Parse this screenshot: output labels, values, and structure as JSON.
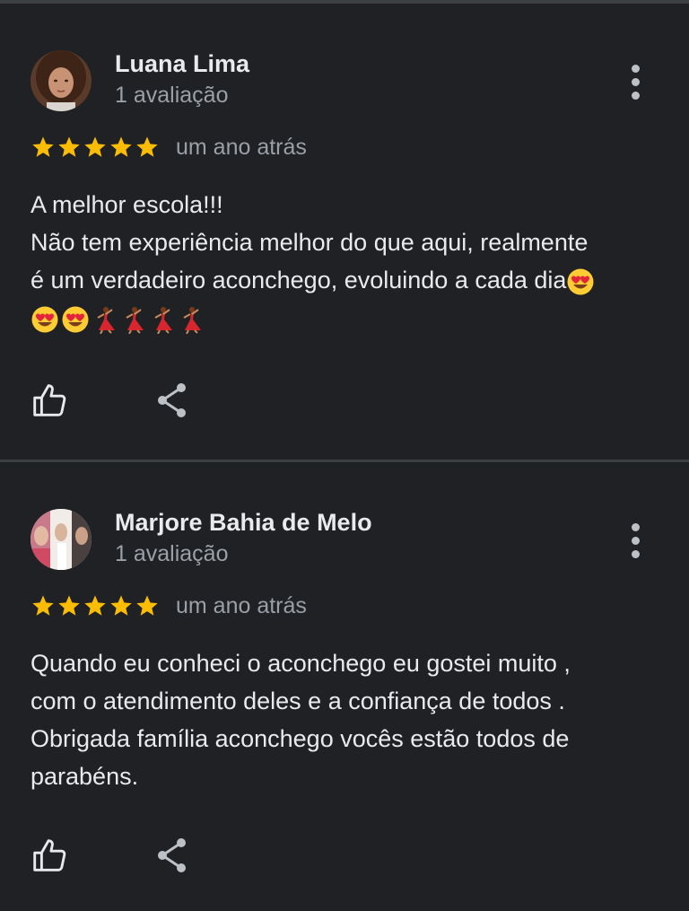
{
  "reviews": [
    {
      "author": "Luana Lima",
      "review_count": "1 avaliação",
      "rating": 5,
      "time": "um ano atrás",
      "lines": [
        "A melhor escola!!!",
        "Não tem experiência melhor do que aqui, realmente",
        "é um verdadeiro aconchego, evoluindo a cada dia"
      ],
      "emojis": [
        "😍",
        "😍",
        "😍",
        "💃",
        "💃",
        "💃",
        "💃"
      ]
    },
    {
      "author": "Marjore Bahia de Melo",
      "review_count": "1 avaliação",
      "rating": 5,
      "time": "um ano atrás",
      "lines": [
        "Quando eu conheci o aconchego eu gostei muito ,",
        "com o atendimento deles e a confiança de todos .",
        "Obrigada família aconchego vocês estão todos de",
        "parabéns."
      ]
    }
  ],
  "colors": {
    "background": "#202124",
    "star": "#fbbc04",
    "text_primary": "#e8eaed",
    "text_secondary": "#9aa0a6",
    "divider": "#3c4043"
  },
  "icons": [
    "more-vert-icon",
    "star-icon",
    "thumb-up-icon",
    "share-icon",
    "heart-eyes-emoji",
    "dancer-emoji"
  ]
}
